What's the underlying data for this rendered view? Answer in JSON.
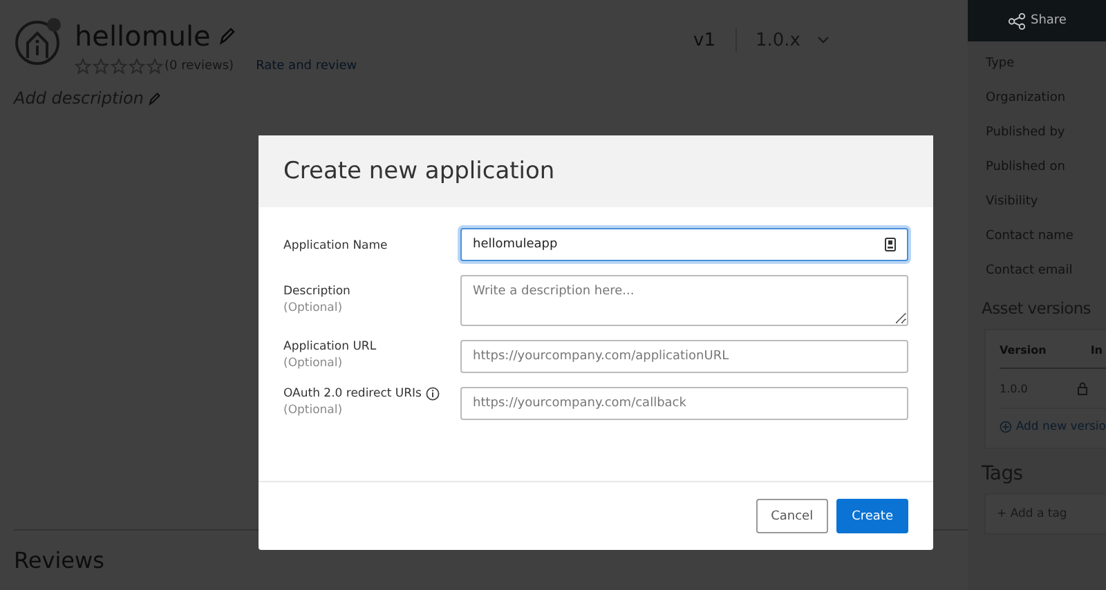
{
  "asset": {
    "title": "hellomule",
    "stars": 0,
    "reviews": "(0 reviews)",
    "rate_link": "Rate and review",
    "description_placeholder": "Add description",
    "version": "v1",
    "version_select": "1.0.x"
  },
  "sidebar": {
    "share": "Share",
    "fields": [
      "Type",
      "Organization",
      "Published by",
      "Published on",
      "Visibility",
      "Contact name",
      "Contact email"
    ],
    "asset_versions": {
      "title": "Asset versions",
      "columns": [
        "Version",
        "In"
      ],
      "rows": [
        {
          "version": "1.0.0",
          "locked": true
        }
      ],
      "add_link": "Add new versio"
    },
    "tags": {
      "title": "Tags",
      "add": "+ Add a tag"
    }
  },
  "reviews_title": "Reviews",
  "dialog": {
    "title": "Create new application",
    "fields": [
      {
        "label": "Application Name",
        "kind": "input",
        "value": "hellomuleapp",
        "focused": true,
        "autofill_icon": true
      },
      {
        "label": "Description",
        "optional": "(Optional)",
        "kind": "textarea",
        "placeholder": "Write a description here...",
        "focused": false
      },
      {
        "label": "Application URL",
        "optional": "(Optional)",
        "kind": "input",
        "placeholder": "https://yourcompany.com/applicationURL",
        "focused": false
      },
      {
        "label": "OAuth 2.0 redirect URIs",
        "info": true,
        "optional": "(Optional)",
        "kind": "input",
        "placeholder": "https://yourcompany.com/callback",
        "focused": false
      }
    ],
    "buttons": [
      {
        "label": "Cancel",
        "kind": "secondary"
      },
      {
        "label": "Create",
        "kind": "primary"
      }
    ]
  }
}
